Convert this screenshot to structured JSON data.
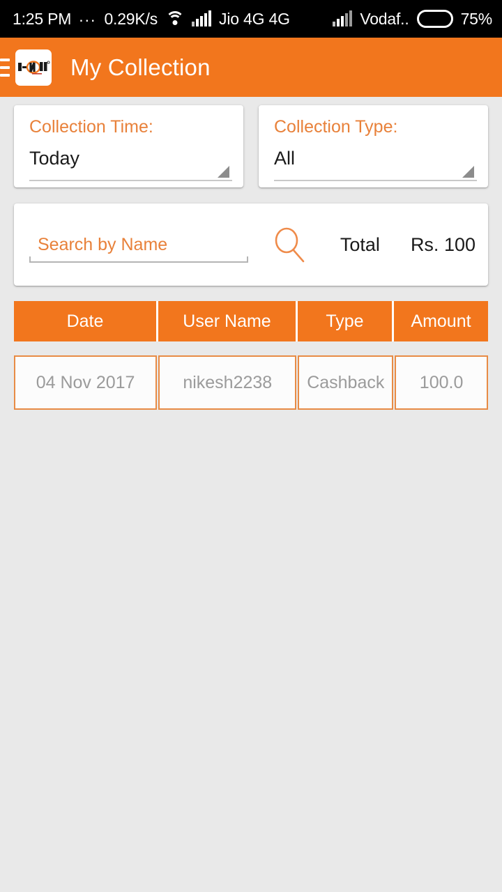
{
  "status_bar": {
    "time": "1:25 PM",
    "dots": "...",
    "data_rate": "0.29K/s",
    "wifi_icon": "wifi-icon",
    "sim1_signal_icon": "signal-bars-icon",
    "sim1_carrier": "Jio 4G 4G",
    "sim2_signal_icon": "signal-bars-icon",
    "sim2_carrier": "Vodaf..",
    "battery_icon": "battery-icon",
    "battery_percent": "75%"
  },
  "app_bar": {
    "menu_icon": "hamburger-menu-icon",
    "logo": "app-logo-icon",
    "logo_text": "I-ON",
    "title": "My Collection",
    "background_color": "#f2761d"
  },
  "filters": [
    {
      "label": "Collection Time:",
      "value": "Today",
      "arrow_icon": "spinner-dropdown-arrow-icon"
    },
    {
      "label": "Collection Type:",
      "value": "All",
      "arrow_icon": "spinner-dropdown-arrow-icon"
    }
  ],
  "search": {
    "value": "",
    "placeholder": "Search by Name",
    "icon": "search-icon",
    "total_label": "Total",
    "total_value": "Rs. 100"
  },
  "table": {
    "columns": [
      "Date",
      "User Name",
      "Type",
      "Amount"
    ],
    "rows": [
      {
        "date": "04 Nov 2017",
        "user_name": "nikesh2238",
        "type": "Cashback",
        "amount": "100.0"
      }
    ]
  },
  "colors": {
    "accent_orange": "#f2761d",
    "label_orange": "#e8813a",
    "row_border_orange": "#e88b45",
    "page_background": "#e9e9e9",
    "card_white": "#ffffff",
    "row_text_gray": "#9b9b9b"
  }
}
